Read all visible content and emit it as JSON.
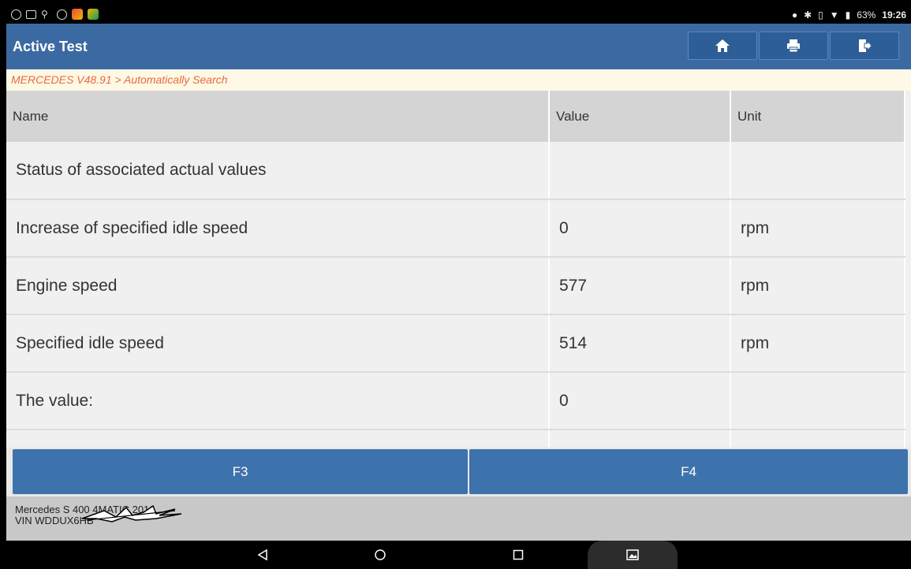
{
  "status_bar": {
    "left_icons": [
      "navigation-icon",
      "screen-icon",
      "usb-icon",
      "bluetooth-off-icon",
      "app-icon",
      "app-icon"
    ],
    "battery": "63%",
    "time": "19:26"
  },
  "header": {
    "title": "Active Test",
    "buttons": [
      "home-icon",
      "print-icon",
      "exit-icon"
    ],
    "accent": "#3b6aa3"
  },
  "breadcrumb": "MERCEDES V48.91 > Automatically Search",
  "table": {
    "columns": [
      "Name",
      "Value",
      "Unit"
    ],
    "rows": [
      {
        "name": "Status of associated actual values",
        "value": "",
        "unit": ""
      },
      {
        "name": "Increase of specified idle speed",
        "value": "0",
        "unit": "rpm"
      },
      {
        "name": "Engine speed",
        "value": "577",
        "unit": "rpm"
      },
      {
        "name": "Specified idle speed",
        "value": "514",
        "unit": "rpm"
      },
      {
        "name": "The value:",
        "value": "0",
        "unit": ""
      },
      {
        "name": "F3",
        "value": "",
        "unit": ""
      }
    ]
  },
  "function_keys": {
    "f3": "F3",
    "f4": "F4"
  },
  "footer": {
    "vehicle": "Mercedes S 400 4MATIC 2016",
    "vin": "VIN WDDUX6HB"
  },
  "nav_bar": [
    "back-icon",
    "home-circle-icon",
    "recents-icon",
    "screenshot-icon"
  ]
}
